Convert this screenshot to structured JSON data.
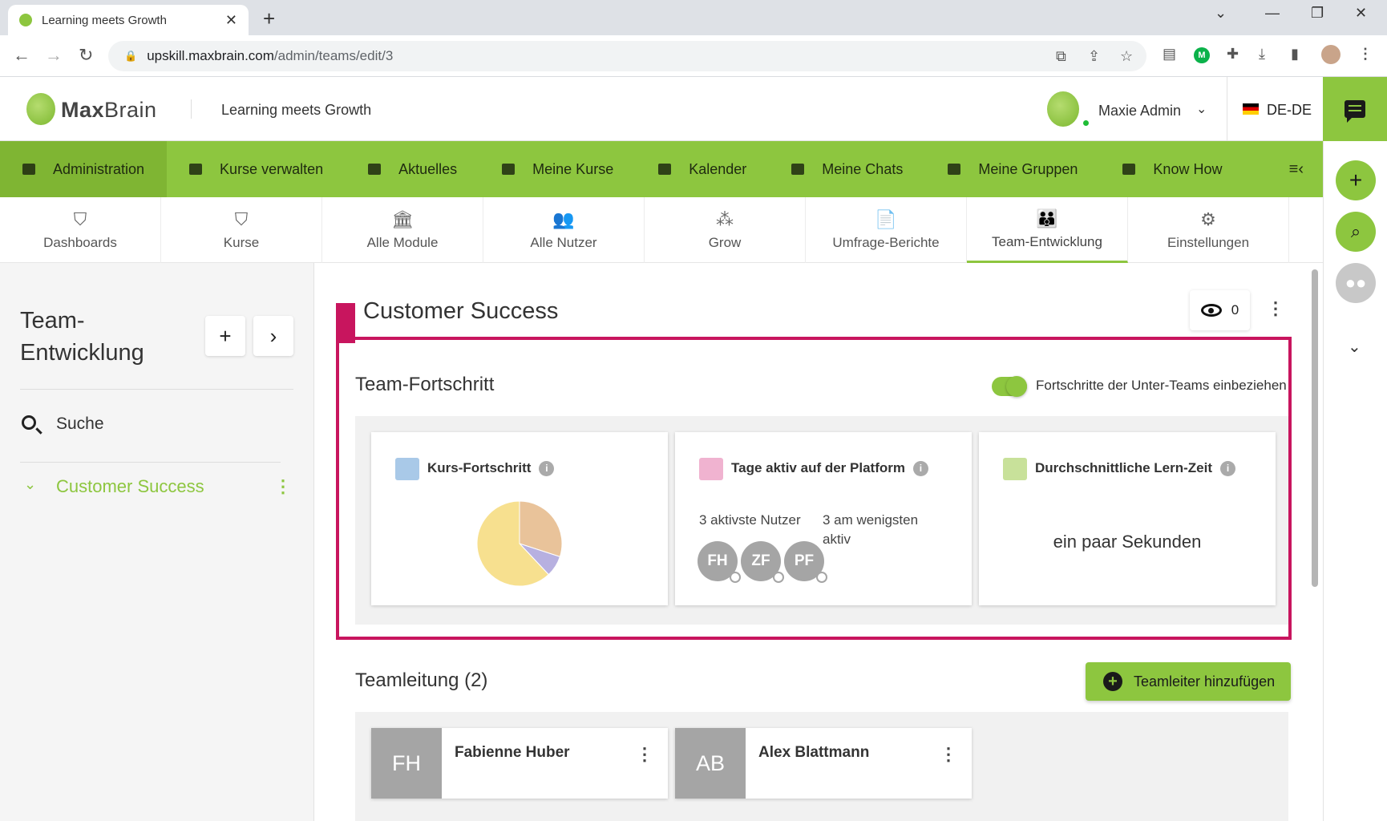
{
  "browser": {
    "tab_title": "Learning meets Growth",
    "url_host": "upskill.maxbrain.com",
    "url_path": "/admin/teams/edit/3"
  },
  "header": {
    "logo_bold": "Max",
    "logo_rest": "Brain",
    "tagline": "Learning meets Growth",
    "user_name": "Maxie Admin",
    "language": "DE-DE"
  },
  "main_nav": [
    {
      "label": "Administration",
      "icon": "admin-icon",
      "active": true
    },
    {
      "label": "Kurse verwalten",
      "icon": "courses-manage-icon"
    },
    {
      "label": "Aktuelles",
      "icon": "news-icon"
    },
    {
      "label": "Meine Kurse",
      "icon": "graduation-cap-icon"
    },
    {
      "label": "Kalender",
      "icon": "calendar-icon"
    },
    {
      "label": "Meine Chats",
      "icon": "chat-icon"
    },
    {
      "label": "Meine Gruppen",
      "icon": "groups-icon"
    },
    {
      "label": "Know How",
      "icon": "book-icon"
    }
  ],
  "sub_nav": [
    {
      "label": "Dashboards",
      "icon": "dashboard-icon"
    },
    {
      "label": "Kurse",
      "icon": "courses-icon"
    },
    {
      "label": "Alle Module",
      "icon": "modules-icon"
    },
    {
      "label": "Alle Nutzer",
      "icon": "users-icon"
    },
    {
      "label": "Grow",
      "icon": "grow-icon"
    },
    {
      "label": "Umfrage-Berichte",
      "icon": "survey-report-icon"
    },
    {
      "label": "Team-Entwicklung",
      "icon": "team-icon",
      "active": true
    },
    {
      "label": "Einstellungen",
      "icon": "settings-icon"
    }
  ],
  "sidebar": {
    "title": "Team-Entwicklung",
    "add_label": "+",
    "next_label": "›",
    "search_label": "Suche",
    "team_label": "Customer Success"
  },
  "team": {
    "title": "Customer Success",
    "views": "0"
  },
  "progress": {
    "title": "Team-Fortschritt",
    "toggle_label": "Fortschritte der Unter-Teams einbeziehen",
    "toggle_on": true,
    "kurs_title": "Kurs-Fortschritt",
    "tage_title": "Tage aktiv auf der Platform",
    "lern_title": "Durchschnittliche Lern-Zeit",
    "most_active_label": "3 aktivste Nutzer",
    "least_active_label": "3 am wenigsten aktiv",
    "most_active_users": [
      "FH",
      "ZF",
      "PF"
    ],
    "avg_learning_time": "ein paar Sekunden"
  },
  "chart_data": {
    "type": "pie",
    "title": "",
    "slices": [
      {
        "value": 30,
        "color": "#e9c39a"
      },
      {
        "value": 8,
        "color": "#b7b0e0"
      },
      {
        "value": 62,
        "color": "#f7e08f"
      }
    ]
  },
  "leaders": {
    "title": "Teamleitung (2)",
    "add_button": "Teamleiter hinzufügen",
    "items": [
      {
        "initials": "FH",
        "name": "Fabienne Huber"
      },
      {
        "initials": "AB",
        "name": "Alex Blattmann"
      }
    ]
  }
}
